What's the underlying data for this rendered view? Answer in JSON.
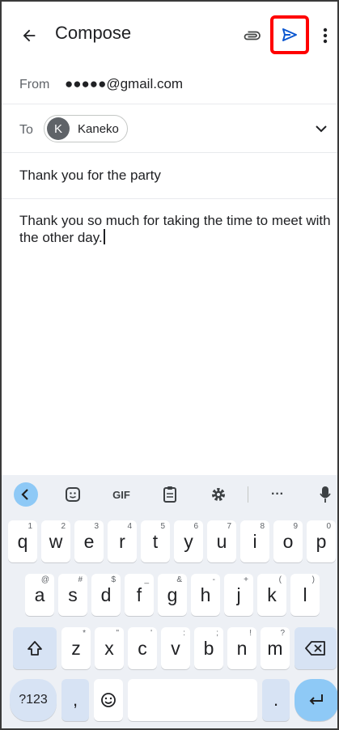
{
  "header": {
    "title": "Compose"
  },
  "from": {
    "label": "From",
    "value": "●●●●●@gmail.com"
  },
  "to": {
    "label": "To",
    "recipient_initial": "K",
    "recipient_name": "Kaneko"
  },
  "subject": {
    "value": "Thank you for the party"
  },
  "body": {
    "value": "Thank you so much for taking the time to meet with the other day."
  },
  "keyboard": {
    "toolbar": {
      "gif_label": "GIF",
      "more_label": "···"
    },
    "row1": [
      {
        "k": "q",
        "h": "1"
      },
      {
        "k": "w",
        "h": "2"
      },
      {
        "k": "e",
        "h": "3"
      },
      {
        "k": "r",
        "h": "4"
      },
      {
        "k": "t",
        "h": "5"
      },
      {
        "k": "y",
        "h": "6"
      },
      {
        "k": "u",
        "h": "7"
      },
      {
        "k": "i",
        "h": "8"
      },
      {
        "k": "o",
        "h": "9"
      },
      {
        "k": "p",
        "h": "0"
      }
    ],
    "row2": [
      {
        "k": "a",
        "h": "@"
      },
      {
        "k": "s",
        "h": "#"
      },
      {
        "k": "d",
        "h": "$"
      },
      {
        "k": "f",
        "h": "_"
      },
      {
        "k": "g",
        "h": "&"
      },
      {
        "k": "h",
        "h": "-"
      },
      {
        "k": "j",
        "h": "+"
      },
      {
        "k": "k",
        "h": "("
      },
      {
        "k": "l",
        "h": ")"
      }
    ],
    "row3": [
      {
        "k": "z",
        "h": "*"
      },
      {
        "k": "x",
        "h": "\""
      },
      {
        "k": "c",
        "h": "'"
      },
      {
        "k": "v",
        "h": ":"
      },
      {
        "k": "b",
        "h": ";"
      },
      {
        "k": "n",
        "h": "!"
      },
      {
        "k": "m",
        "h": "?"
      }
    ],
    "symbols_label": "?123",
    "comma_label": ",",
    "period_label": "."
  },
  "colors": {
    "send": "#0b57d0",
    "highlight": "#ff0000",
    "enter_key": "#8ec9f6"
  }
}
